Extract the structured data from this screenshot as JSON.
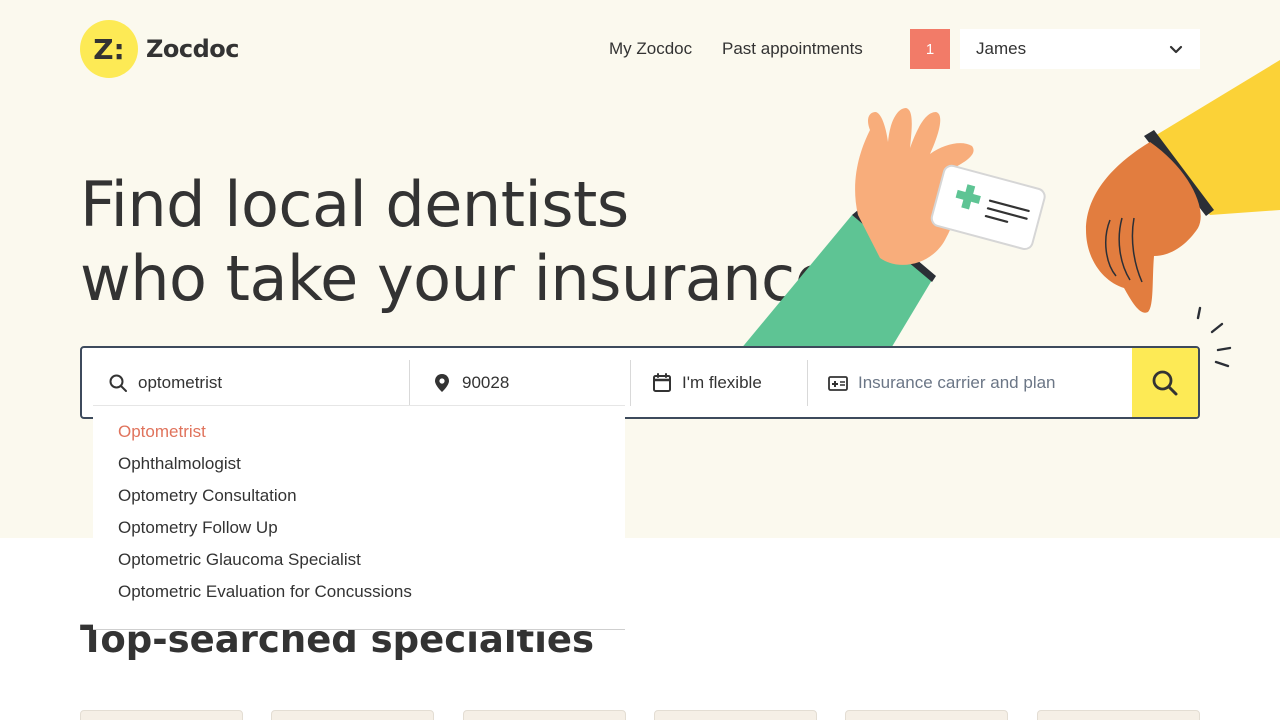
{
  "brand": {
    "name": "Zocdoc",
    "mark": "Z:",
    "accent": "#fdea55"
  },
  "nav": {
    "my_zocdoc": "My Zocdoc",
    "past_appointments": "Past appointments",
    "notification_count": "1",
    "notification_color": "#f27b68",
    "user_name": "James"
  },
  "hero": {
    "headline_line1": "Find local dentists",
    "headline_line2": "who take your insurance",
    "background": "#fbf9ee"
  },
  "search": {
    "specialty_value": "optometrist",
    "location_value": "90028",
    "date_label": "I'm flexible",
    "insurance_placeholder": "Insurance carrier and plan",
    "border_color": "#3d4a5c"
  },
  "suggestions": [
    {
      "label": "Optometrist"
    },
    {
      "label": "Ophthalmologist"
    },
    {
      "label": "Optometry Consultation"
    },
    {
      "label": "Optometry Follow Up"
    },
    {
      "label": "Optometric Glaucoma Specialist"
    },
    {
      "label": "Optometric Evaluation for Concussions"
    }
  ],
  "section": {
    "title": "Top-searched specialties"
  }
}
